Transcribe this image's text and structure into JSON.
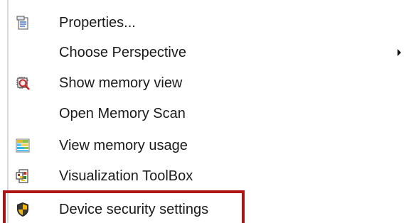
{
  "menu": {
    "items": [
      {
        "label": "Properties...",
        "icon": "properties-icon",
        "has_submenu": false
      },
      {
        "label": "Choose Perspective",
        "icon": "",
        "has_submenu": true
      },
      {
        "label": "Show memory view",
        "icon": "memory-view-icon",
        "has_submenu": false
      },
      {
        "label": "Open Memory Scan",
        "icon": "",
        "has_submenu": false
      },
      {
        "label": "View memory usage",
        "icon": "memory-usage-icon",
        "has_submenu": false
      },
      {
        "label": "Visualization ToolBox",
        "icon": "visualization-toolbox-icon",
        "has_submenu": false
      },
      {
        "label": "Device security settings",
        "icon": "shield-icon",
        "has_submenu": false,
        "highlighted": true
      }
    ]
  },
  "colors": {
    "highlight_border": "#b01515",
    "text": "#1a1a1a",
    "background": "#ffffff"
  }
}
